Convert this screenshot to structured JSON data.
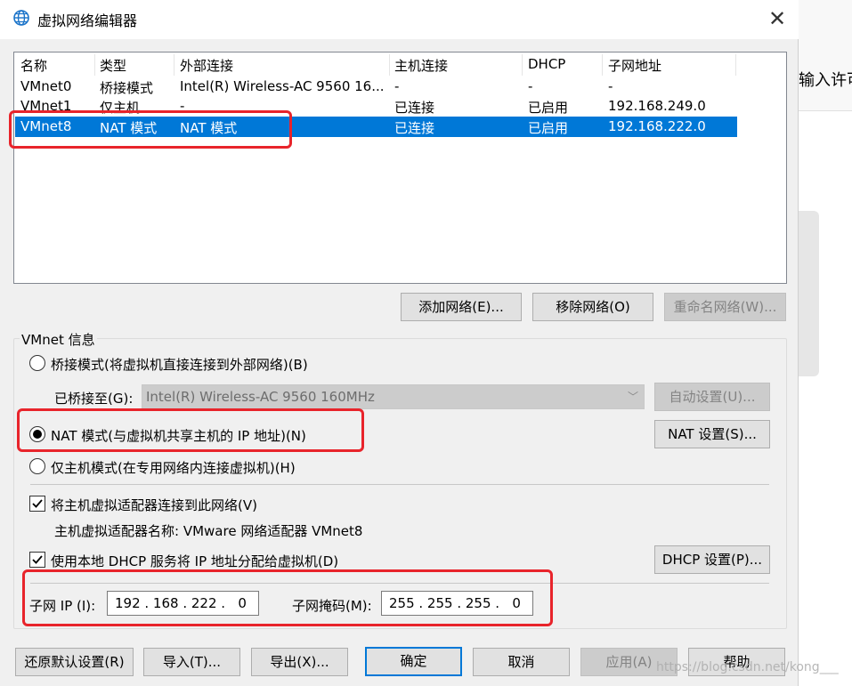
{
  "window": {
    "title": "虚拟网络编辑器",
    "close_glyph": "✕"
  },
  "background_app": {
    "partial_text": "输入许可"
  },
  "list": {
    "headers": [
      "名称",
      "类型",
      "外部连接",
      "主机连接",
      "DHCP",
      "子网地址"
    ],
    "rows": [
      {
        "name": "VMnet0",
        "type": "桥接模式",
        "external": "Intel(R) Wireless-AC 9560 16...",
        "host": "-",
        "dhcp": "-",
        "subnet": "-"
      },
      {
        "name": "VMnet1",
        "type": "仅主机",
        "external": "-",
        "host": "已连接",
        "dhcp": "已启用",
        "subnet": "192.168.249.0"
      },
      {
        "name": "VMnet8",
        "type": "NAT 模式",
        "external": "NAT 模式",
        "host": "已连接",
        "dhcp": "已启用",
        "subnet": "192.168.222.0"
      }
    ],
    "selected_row": 2
  },
  "list_buttons": {
    "add": "添加网络(E)...",
    "remove": "移除网络(O)",
    "rename": "重命名网络(W)..."
  },
  "vmnet_info": {
    "group_title": "VMnet 信息",
    "bridge_radio": "桥接模式(将虚拟机直接连接到外部网络)(B)",
    "bridged_to_label": "已桥接至(G):",
    "bridged_to_value": "Intel(R) Wireless-AC 9560 160MHz",
    "auto_button": "自动设置(U)...",
    "nat_radio": "NAT 模式(与虚拟机共享主机的 IP 地址)(N)",
    "nat_button": "NAT 设置(S)...",
    "hostonly_radio": "仅主机模式(在专用网络内连接虚拟机)(H)",
    "connect_adapter_check": "将主机虚拟适配器连接到此网络(V)",
    "adapter_name_text": "主机虚拟适配器名称: VMware 网络适配器 VMnet8",
    "dhcp_check": "使用本地 DHCP 服务将 IP 地址分配给虚拟机(D)",
    "dhcp_button": "DHCP 设置(P)...",
    "subnet_ip_label": "子网 IP (I):",
    "subnet_ip_value": "192 . 168 . 222 .   0",
    "subnet_mask_label": "子网掩码(M):",
    "subnet_mask_value": "255 . 255 . 255 .   0",
    "selected_mode": "nat",
    "connect_adapter_checked": true,
    "dhcp_checked": true
  },
  "bottom_buttons": {
    "restore": "还原默认设置(R)",
    "import": "导入(T)...",
    "export": "导出(X)...",
    "ok": "确定",
    "cancel": "取消",
    "apply": "应用(A)",
    "help": "帮助"
  },
  "watermark": "https://blog.csdn.net/kong___",
  "colors": {
    "selection": "#0078d7",
    "highlight_box": "#e8242b"
  }
}
